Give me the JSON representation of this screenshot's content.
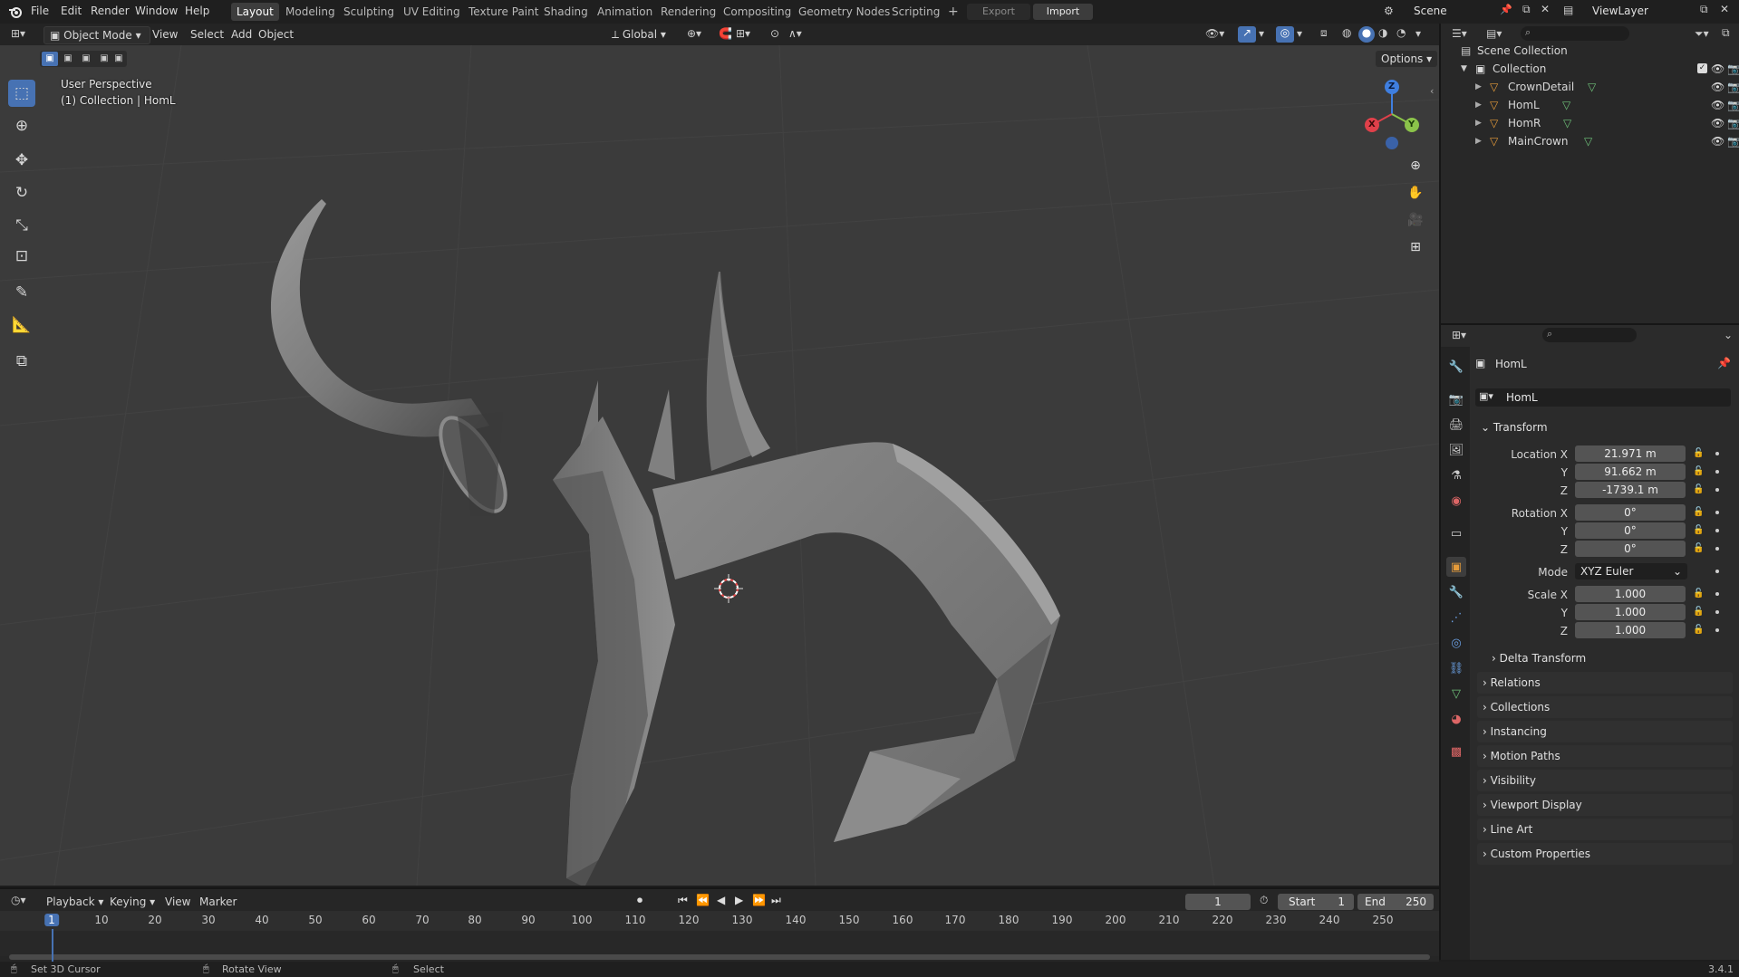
{
  "topbar": {
    "menus": [
      "File",
      "Edit",
      "Render",
      "Window",
      "Help"
    ],
    "workspaces": [
      "Layout",
      "Modeling",
      "Sculpting",
      "UV Editing",
      "Texture Paint",
      "Shading",
      "Animation",
      "Rendering",
      "Compositing",
      "Geometry Nodes",
      "Scripting"
    ],
    "active_workspace": "Layout",
    "add_tab": "+",
    "export_label": "Export",
    "import_label": "Import",
    "scene_name": "Scene",
    "view_layer": "ViewLayer"
  },
  "viewport_header": {
    "mode": "Object Mode",
    "menus": [
      "View",
      "Select",
      "Add",
      "Object"
    ],
    "orientation": "Global",
    "options_label": "Options"
  },
  "viewport": {
    "perspective": "User Perspective",
    "collection_info": "(1) Collection | HomL",
    "gizmo_axes": {
      "x": "X",
      "y": "Y",
      "z": "Z"
    }
  },
  "outliner": {
    "root": "Scene Collection",
    "collection": "Collection",
    "objects": [
      "CrownDetail",
      "HomL",
      "HomR",
      "MainCrown"
    ]
  },
  "properties": {
    "object_name": "HomL",
    "data_name": "HomL",
    "transform_label": "Transform",
    "location": {
      "label": "Location X",
      "x": "21.971 m",
      "y": "91.662 m",
      "z": "-1739.1 m"
    },
    "rotation": {
      "label": "Rotation X",
      "x": "0°",
      "y": "0°",
      "z": "0°"
    },
    "mode_label": "Mode",
    "mode_value": "XYZ Euler",
    "scale": {
      "label": "Scale X",
      "x": "1.000",
      "y": "1.000",
      "z": "1.000"
    },
    "axis_y": "Y",
    "axis_z": "Z",
    "delta_transform": "Delta Transform",
    "sections": [
      "Relations",
      "Collections",
      "Instancing",
      "Motion Paths",
      "Visibility",
      "Viewport Display",
      "Line Art",
      "Custom Properties"
    ]
  },
  "timeline": {
    "menus": [
      "Playback",
      "Keying",
      "View",
      "Marker"
    ],
    "current_frame": "1",
    "start_label": "Start",
    "start_value": "1",
    "end_label": "End",
    "end_value": "250",
    "ticks": [
      "1",
      "10",
      "20",
      "30",
      "40",
      "50",
      "60",
      "70",
      "80",
      "90",
      "100",
      "110",
      "120",
      "130",
      "140",
      "150",
      "160",
      "170",
      "180",
      "190",
      "200",
      "210",
      "220",
      "230",
      "240",
      "250"
    ]
  },
  "statusbar": {
    "hints": [
      "Set 3D Cursor",
      "Rotate View",
      "Select"
    ],
    "version": "3.4.1"
  },
  "colors": {
    "accent": "#4772b3",
    "axis_x": "#e0404a",
    "axis_y": "#8bc34a",
    "axis_z": "#3f7fe0",
    "object_orange": "#e59b3a",
    "mesh_green": "#6fc27a"
  }
}
